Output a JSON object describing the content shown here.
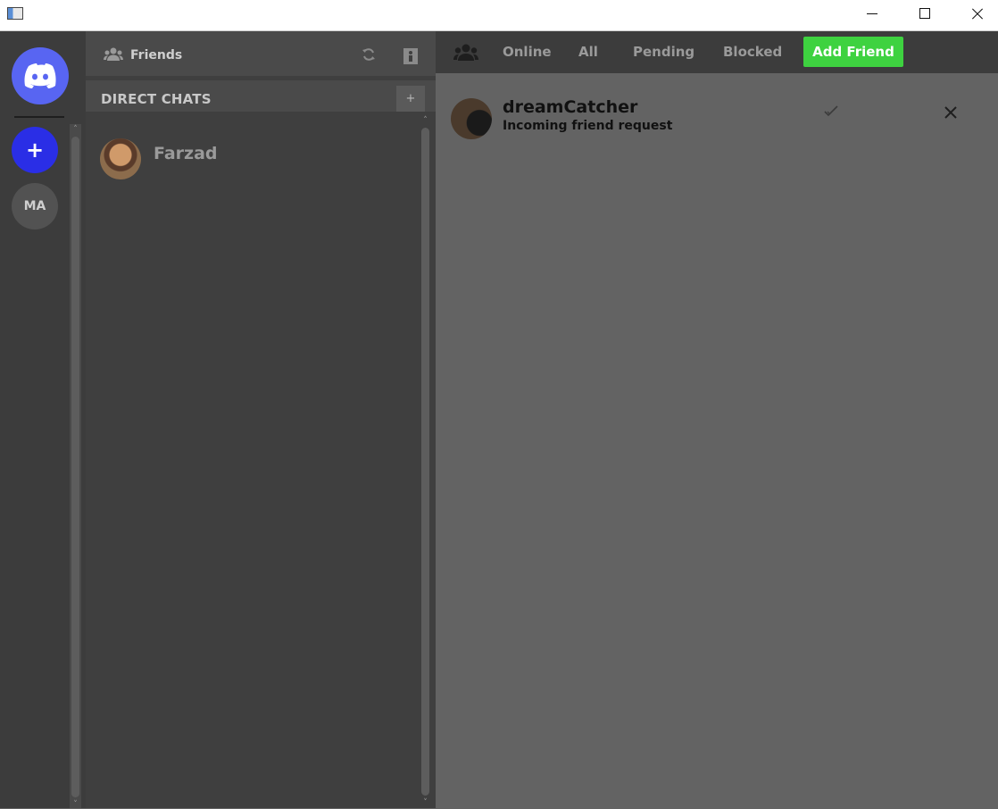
{
  "window": {
    "icons": {
      "app": "app-icon",
      "minimize": "minimize-icon",
      "maximize": "maximize-icon",
      "close": "close-icon"
    }
  },
  "servers": {
    "home_icon": "discord-logo-icon",
    "add_label": "+",
    "items": [
      {
        "label": "MA"
      }
    ]
  },
  "sidebar": {
    "friends_label": "Friends",
    "direct_chats_label": "DIRECT CHATS",
    "add_label": "+",
    "dms": [
      {
        "name": "Farzad"
      }
    ]
  },
  "main": {
    "tabs": [
      {
        "label": "Online"
      },
      {
        "label": "All"
      },
      {
        "label": "Pending"
      },
      {
        "label": "Blocked"
      }
    ],
    "add_friend_label": "Add Friend",
    "requests": [
      {
        "name": "dreamCatcher",
        "status": "Incoming friend request"
      }
    ]
  },
  "colors": {
    "brand": "#5865f2",
    "add_server": "#2a2ee6",
    "add_friend": "#3ed240"
  }
}
